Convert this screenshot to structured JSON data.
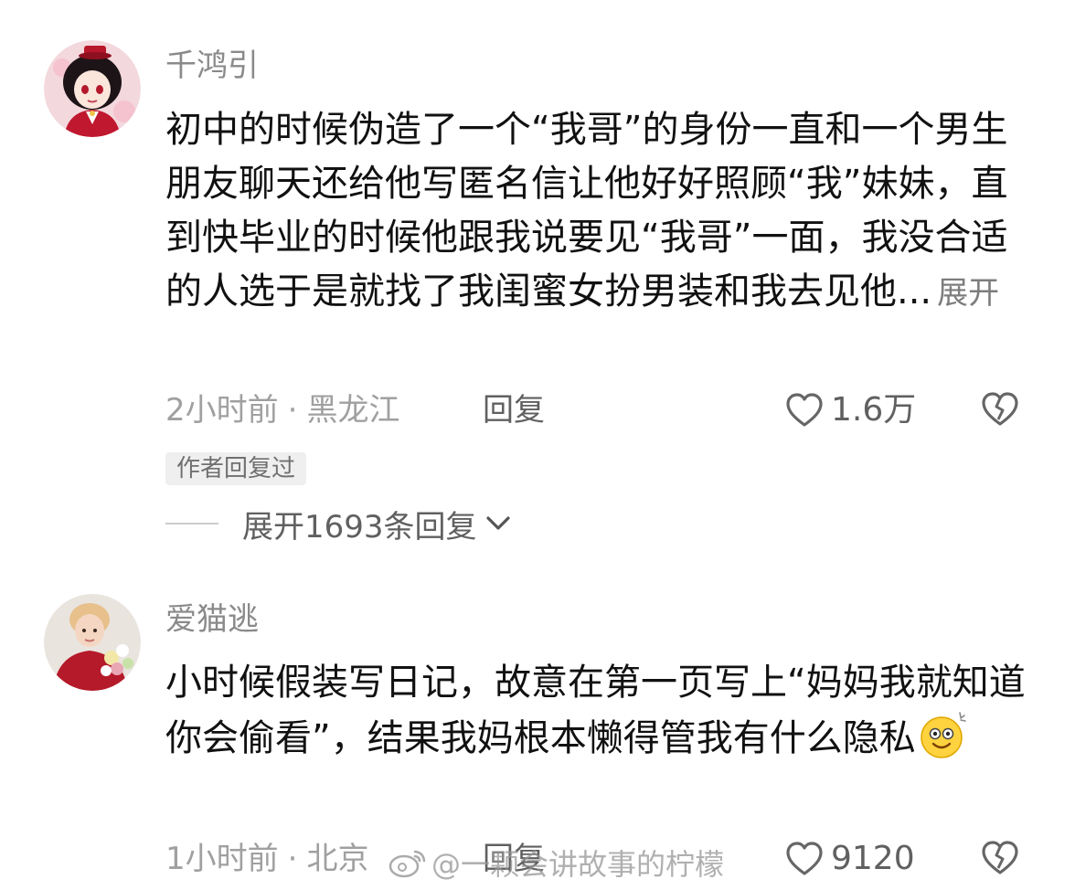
{
  "comments": [
    {
      "username": "千鸿引",
      "text": "初中的时候伪造了一个“我哥”的身份一直和一个男生朋友聊天还给他写匿名信让他好好照顾“我”妹妹，直到快毕业的时候他跟我说要见“我哥”一面，我没合适的人选于是就找了我闺蜜女扮男装和我去见他...",
      "expand_label": "展开",
      "time": "2小时前",
      "location": "黑龙江",
      "reply_label": "回复",
      "like_count": "1.6万",
      "author_badge": "作者回复过",
      "expand_replies_label": "展开1693条回复",
      "avatar_icon": "anime-girl-avatar"
    },
    {
      "username": "爱猫逃",
      "text": "小时候假装写日记，故意在第一页写上“妈妈我就知道你会偷看”，结果我妈根本懒得管我有什么隐私",
      "emoji": "smiling-face-emoji",
      "time": "1小时前",
      "location": "北京",
      "reply_label": "回复",
      "like_count": "9120",
      "avatar_icon": "person-with-flowers-avatar"
    }
  ],
  "meta_separator": "·",
  "watermark": {
    "text": "@一颗会讲故事的柠檬",
    "icon": "weibo-icon"
  },
  "colors": {
    "username": "#8a8a8a",
    "body": "#111111",
    "meta": "#a0a0a0",
    "action": "#606060",
    "badge_bg": "#efefef"
  }
}
